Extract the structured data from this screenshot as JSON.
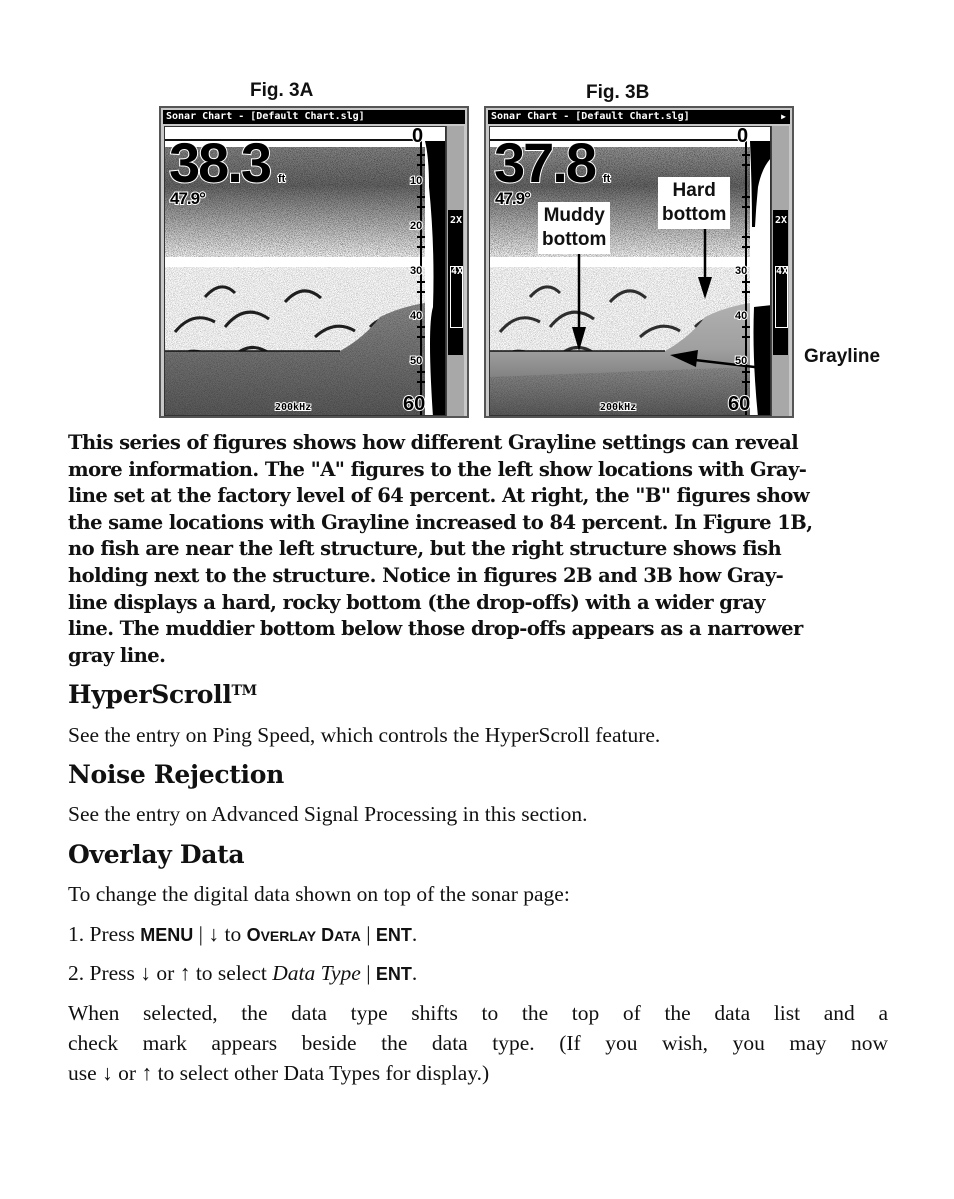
{
  "figures": [
    {
      "label": "Fig. 3A",
      "screen": {
        "title": "Sonar Chart - [Default Chart.slg]",
        "depth": "38.3",
        "depth_unit": "ft",
        "temperature": "47.9°",
        "frequency": "200kHz",
        "scale": [
          "0",
          "10",
          "20",
          "30",
          "40",
          "50",
          "60"
        ],
        "zoom_levels": [
          "2X",
          "4X"
        ],
        "selected_zoom": "4X"
      }
    },
    {
      "label": "Fig. 3B",
      "screen": {
        "title": "Sonar Chart - [Default Chart.slg]",
        "depth": "37.8",
        "depth_unit": "ft",
        "temperature": "47.9°",
        "frequency": "200kHz",
        "scale": [
          "0",
          "10",
          "20",
          "30",
          "40",
          "50",
          "60"
        ],
        "zoom_levels": [
          "2X",
          "4X"
        ],
        "selected_zoom": "4X"
      },
      "callouts": {
        "muddy": [
          "Muddy",
          "bottom"
        ],
        "hard": [
          "Hard",
          "bottom"
        ]
      }
    }
  ],
  "grayline_label": "Grayline",
  "caption": "This series of figures shows how different Grayline settings can reveal more information. The \"A\" figures to the left show locations with Gray-line set at the factory level of 64 percent. At right, the \"B\" figures show the same locations with Grayline increased to 84 percent. In Figure 1B, no fish are near the left structure, but the right structure shows fish holding next to the structure. Notice in figures 2B and 3B how Gray-line displays a hard, rocky bottom (the drop-offs) with a wider gray line. The muddier bottom below those drop-offs appears as a narrower gray line.",
  "caption_lines": [
    "This series of figures shows how different Grayline settings can reveal",
    "more information. The \"A\" figures to the left show locations with Gray-",
    "line set at the factory level of 64 percent. At right, the \"B\" figures show",
    "the same locations with Grayline increased to 84 percent. In Figure 1B,",
    "no fish are near the left structure, but the right structure shows fish",
    "holding next to the structure. Notice in figures 2B and 3B how Gray-",
    "line displays a hard, rocky bottom (the drop-offs) with a wider gray",
    "line. The muddier bottom below those drop-offs appears as a narrower",
    "gray line."
  ],
  "sections": {
    "hyperscroll": {
      "heading": "HyperScroll",
      "trademark": "TM",
      "body": "See the entry on Ping Speed, which controls the HyperScroll feature."
    },
    "noise_rejection": {
      "heading": "Noise Rejection",
      "body": "See the entry on Advanced Signal Processing in this section."
    },
    "overlay_data": {
      "heading": "Overlay Data",
      "intro": "To change the digital data shown on top of the sonar page:",
      "step1": {
        "num": "1. Press ",
        "key1": "MENU",
        "sep": " | ",
        "arrow": "↓",
        "to": " to ",
        "menu_o": "O",
        "menu_verlay": "VERLAY",
        "menu_d": " D",
        "menu_ata": "ATA",
        "sep2": " | ",
        "key2": "ENT",
        "end": "."
      },
      "step2": {
        "num": "2. Press ",
        "down": "↓",
        "or": " or ",
        "up": "↑",
        "to_select": " to select ",
        "item": "Data Type",
        "sep": " | ",
        "key": "ENT",
        "end": "."
      },
      "body_lines": [
        "When selected, the data type shifts to the top of the data list and a",
        "check mark appears beside the data type. (If you wish, you may now",
        "use ↓ or ↑ to select other Data Types for display.)"
      ]
    }
  }
}
